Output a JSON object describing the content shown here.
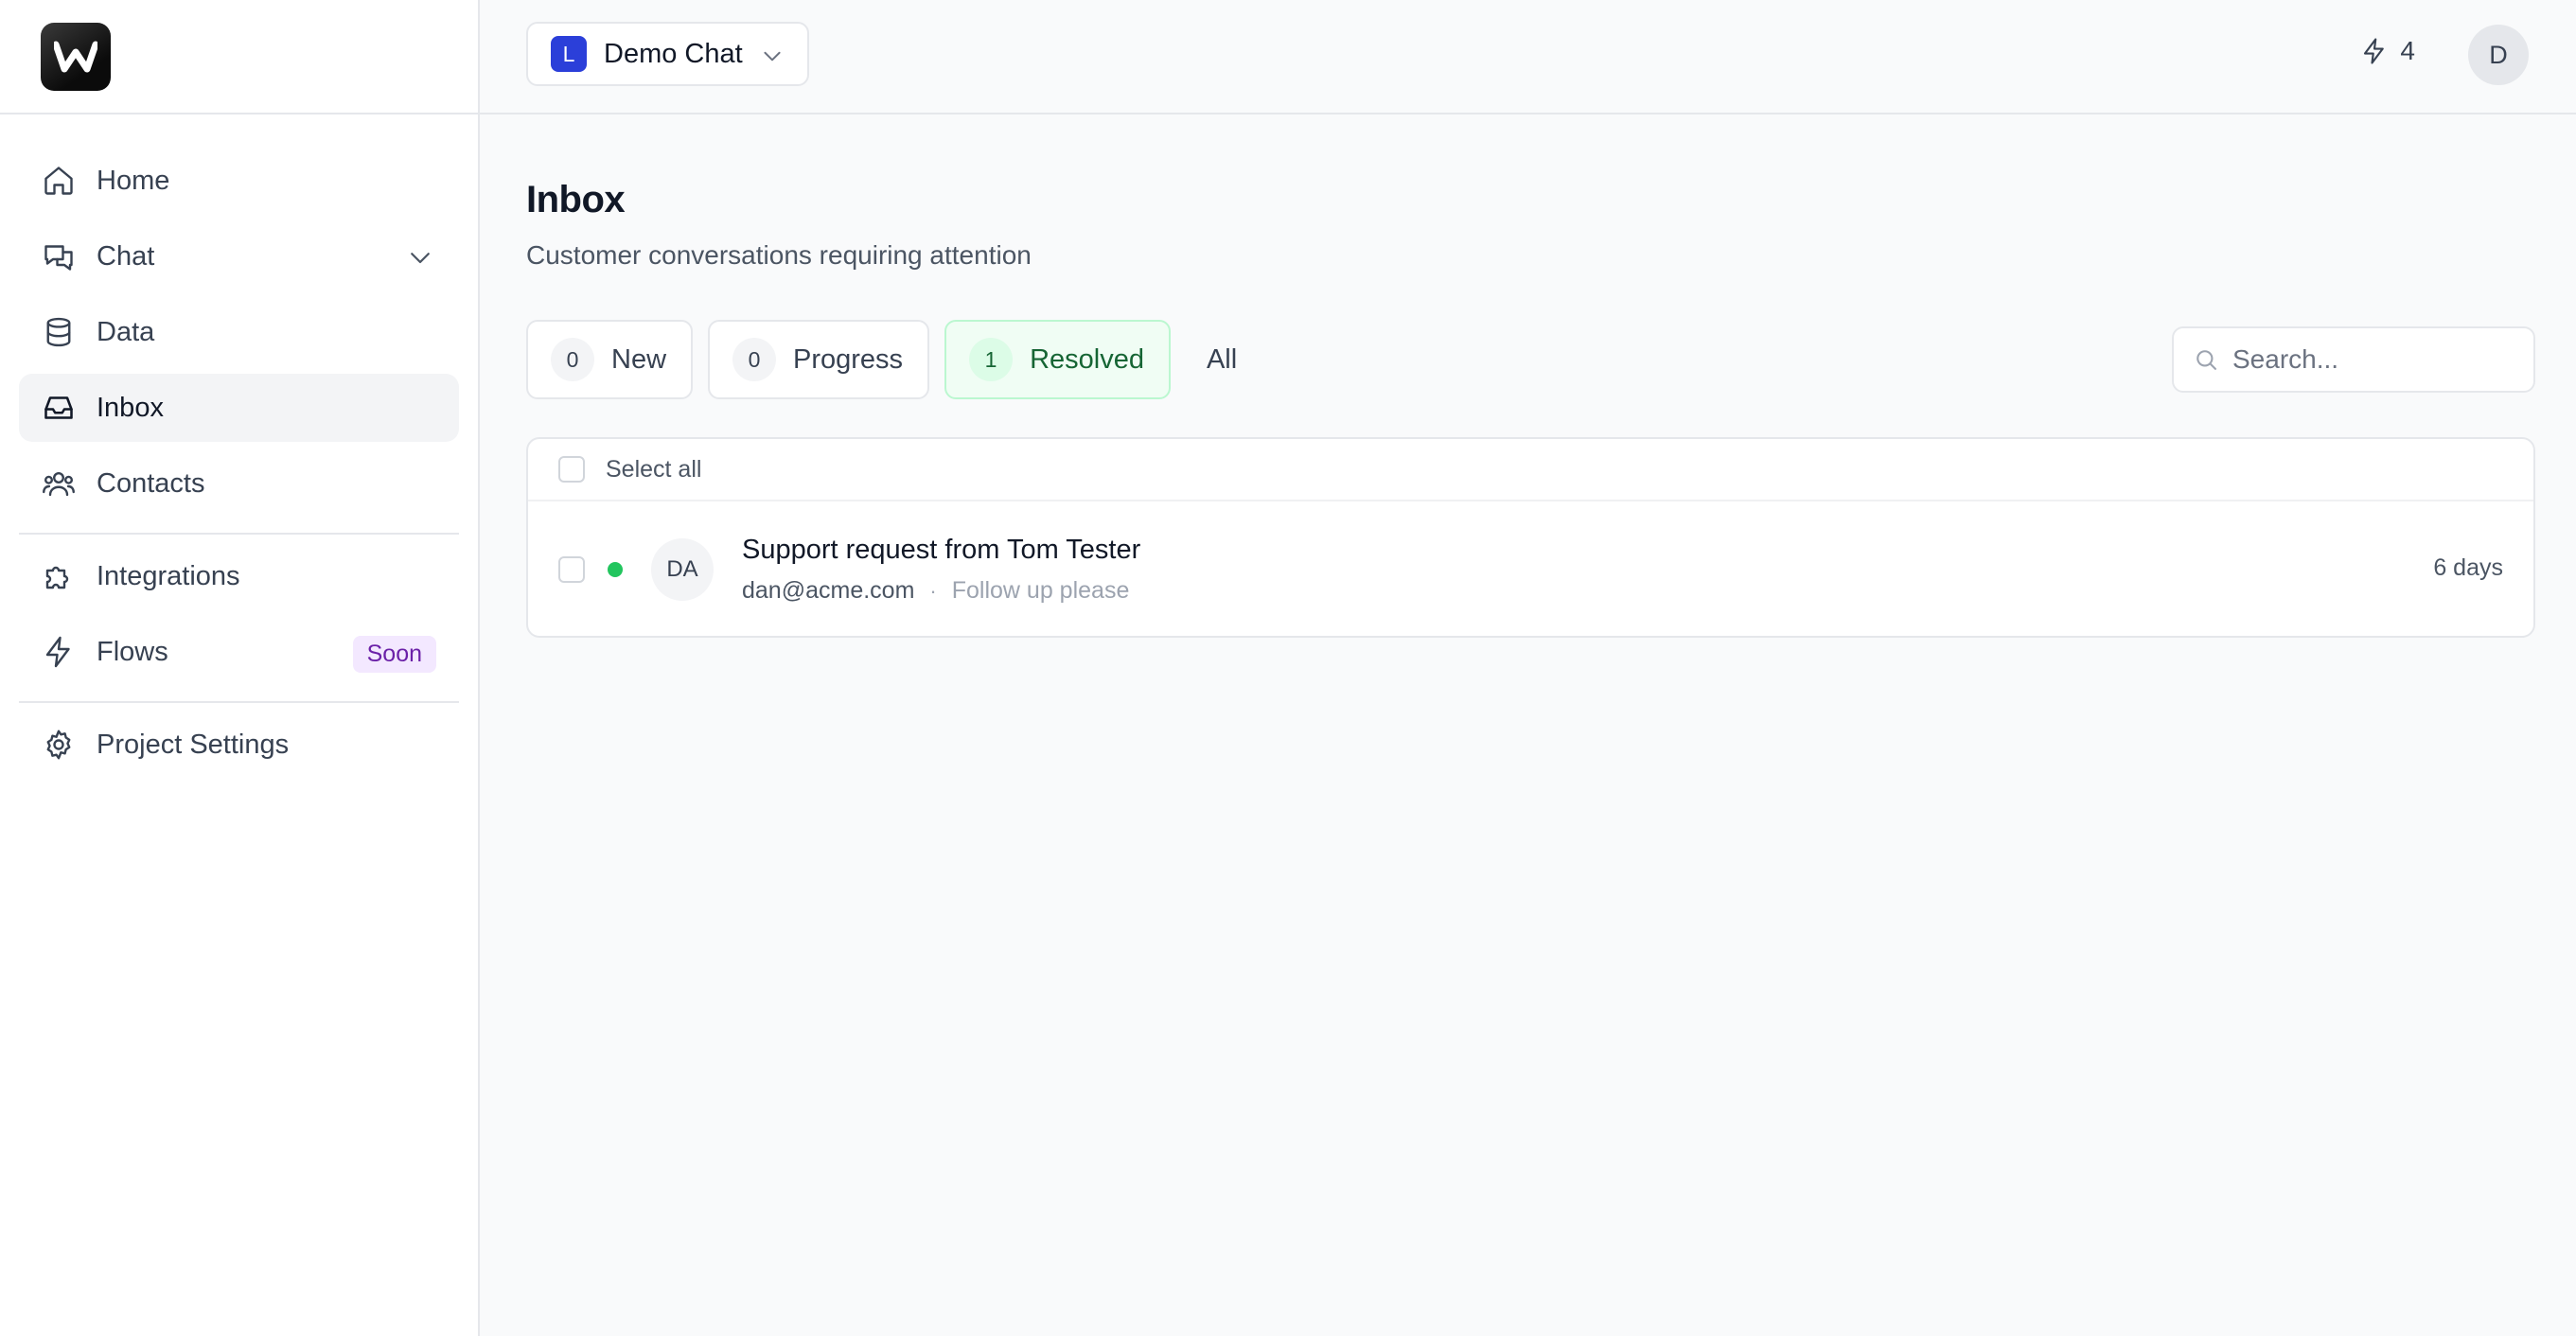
{
  "app": {
    "logo_letter": "w"
  },
  "sidebar": {
    "items": [
      {
        "label": "Home",
        "icon": "home-icon"
      },
      {
        "label": "Chat",
        "icon": "chat-icon"
      },
      {
        "label": "Data",
        "icon": "database-icon"
      },
      {
        "label": "Inbox",
        "icon": "inbox-icon"
      },
      {
        "label": "Contacts",
        "icon": "users-icon"
      },
      {
        "label": "Integrations",
        "icon": "puzzle-icon"
      },
      {
        "label": "Flows",
        "icon": "bolt-icon",
        "badge": "Soon"
      },
      {
        "label": "Project Settings",
        "icon": "gear-icon"
      }
    ],
    "active": "Inbox"
  },
  "topbar": {
    "project_initial": "L",
    "project_name": "Demo Chat",
    "credits": "4",
    "user_initial": "D"
  },
  "main": {
    "title": "Inbox",
    "subtitle": "Customer conversations requiring attention",
    "filters": [
      {
        "count": "0",
        "label": "New"
      },
      {
        "count": "0",
        "label": "Progress"
      },
      {
        "count": "1",
        "label": "Resolved",
        "active": true
      }
    ],
    "filter_all": "All",
    "search_placeholder": "Search...",
    "select_all": "Select all",
    "conversations": [
      {
        "initials": "DA",
        "title": "Support request from Tom Tester",
        "email": "dan@acme.com",
        "preview": "Follow up please",
        "time": "6 days",
        "status_color": "#22c55e"
      }
    ]
  },
  "colors": {
    "accent_project": "#2b3fd9",
    "resolved_bg": "#f0fdf4",
    "resolved_text": "#166534",
    "soon_badge_bg": "#f3e8ff",
    "soon_badge_text": "#6b21a8"
  }
}
